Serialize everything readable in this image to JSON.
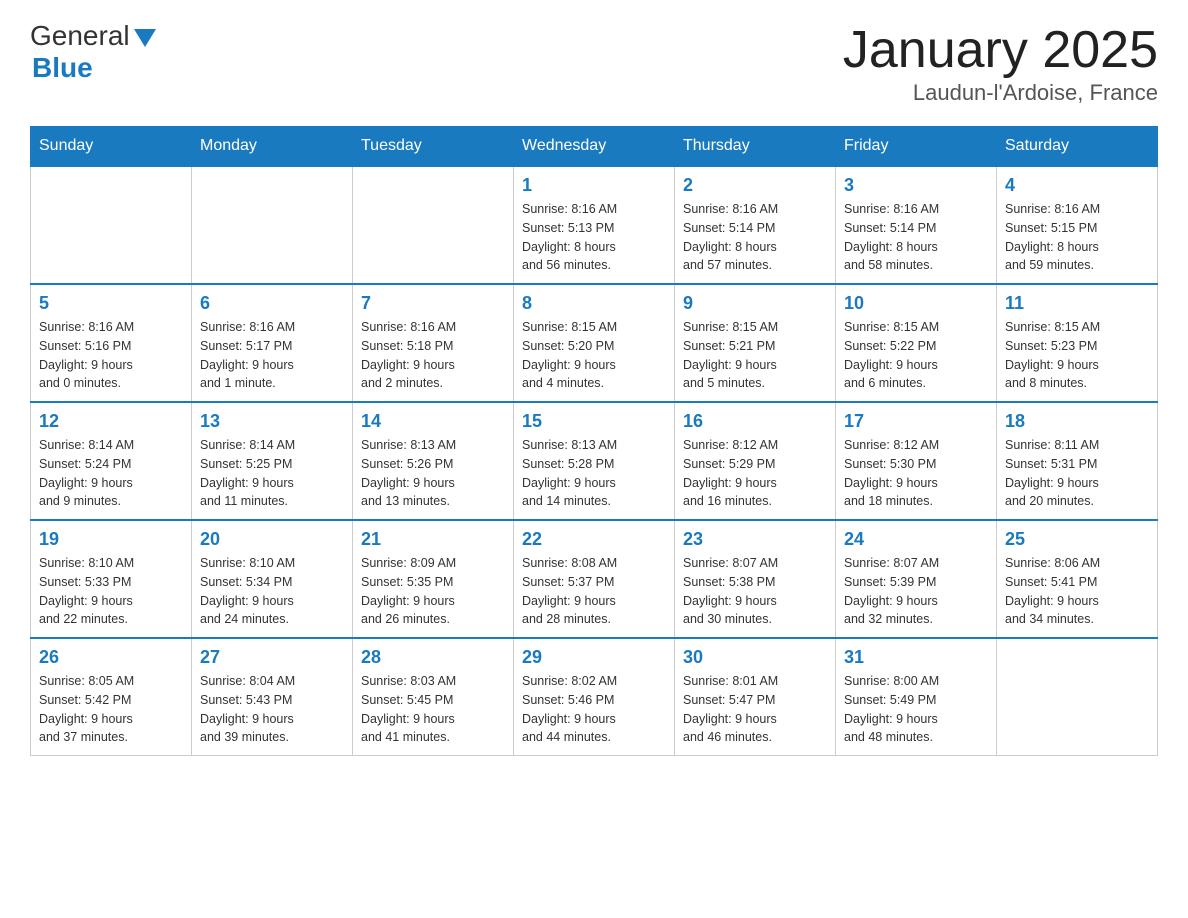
{
  "header": {
    "logo_general": "General",
    "logo_blue": "Blue",
    "month_title": "January 2025",
    "location": "Laudun-l'Ardoise, France"
  },
  "weekdays": [
    "Sunday",
    "Monday",
    "Tuesday",
    "Wednesday",
    "Thursday",
    "Friday",
    "Saturday"
  ],
  "weeks": [
    [
      {
        "day": "",
        "info": ""
      },
      {
        "day": "",
        "info": ""
      },
      {
        "day": "",
        "info": ""
      },
      {
        "day": "1",
        "info": "Sunrise: 8:16 AM\nSunset: 5:13 PM\nDaylight: 8 hours\nand 56 minutes."
      },
      {
        "day": "2",
        "info": "Sunrise: 8:16 AM\nSunset: 5:14 PM\nDaylight: 8 hours\nand 57 minutes."
      },
      {
        "day": "3",
        "info": "Sunrise: 8:16 AM\nSunset: 5:14 PM\nDaylight: 8 hours\nand 58 minutes."
      },
      {
        "day": "4",
        "info": "Sunrise: 8:16 AM\nSunset: 5:15 PM\nDaylight: 8 hours\nand 59 minutes."
      }
    ],
    [
      {
        "day": "5",
        "info": "Sunrise: 8:16 AM\nSunset: 5:16 PM\nDaylight: 9 hours\nand 0 minutes."
      },
      {
        "day": "6",
        "info": "Sunrise: 8:16 AM\nSunset: 5:17 PM\nDaylight: 9 hours\nand 1 minute."
      },
      {
        "day": "7",
        "info": "Sunrise: 8:16 AM\nSunset: 5:18 PM\nDaylight: 9 hours\nand 2 minutes."
      },
      {
        "day": "8",
        "info": "Sunrise: 8:15 AM\nSunset: 5:20 PM\nDaylight: 9 hours\nand 4 minutes."
      },
      {
        "day": "9",
        "info": "Sunrise: 8:15 AM\nSunset: 5:21 PM\nDaylight: 9 hours\nand 5 minutes."
      },
      {
        "day": "10",
        "info": "Sunrise: 8:15 AM\nSunset: 5:22 PM\nDaylight: 9 hours\nand 6 minutes."
      },
      {
        "day": "11",
        "info": "Sunrise: 8:15 AM\nSunset: 5:23 PM\nDaylight: 9 hours\nand 8 minutes."
      }
    ],
    [
      {
        "day": "12",
        "info": "Sunrise: 8:14 AM\nSunset: 5:24 PM\nDaylight: 9 hours\nand 9 minutes."
      },
      {
        "day": "13",
        "info": "Sunrise: 8:14 AM\nSunset: 5:25 PM\nDaylight: 9 hours\nand 11 minutes."
      },
      {
        "day": "14",
        "info": "Sunrise: 8:13 AM\nSunset: 5:26 PM\nDaylight: 9 hours\nand 13 minutes."
      },
      {
        "day": "15",
        "info": "Sunrise: 8:13 AM\nSunset: 5:28 PM\nDaylight: 9 hours\nand 14 minutes."
      },
      {
        "day": "16",
        "info": "Sunrise: 8:12 AM\nSunset: 5:29 PM\nDaylight: 9 hours\nand 16 minutes."
      },
      {
        "day": "17",
        "info": "Sunrise: 8:12 AM\nSunset: 5:30 PM\nDaylight: 9 hours\nand 18 minutes."
      },
      {
        "day": "18",
        "info": "Sunrise: 8:11 AM\nSunset: 5:31 PM\nDaylight: 9 hours\nand 20 minutes."
      }
    ],
    [
      {
        "day": "19",
        "info": "Sunrise: 8:10 AM\nSunset: 5:33 PM\nDaylight: 9 hours\nand 22 minutes."
      },
      {
        "day": "20",
        "info": "Sunrise: 8:10 AM\nSunset: 5:34 PM\nDaylight: 9 hours\nand 24 minutes."
      },
      {
        "day": "21",
        "info": "Sunrise: 8:09 AM\nSunset: 5:35 PM\nDaylight: 9 hours\nand 26 minutes."
      },
      {
        "day": "22",
        "info": "Sunrise: 8:08 AM\nSunset: 5:37 PM\nDaylight: 9 hours\nand 28 minutes."
      },
      {
        "day": "23",
        "info": "Sunrise: 8:07 AM\nSunset: 5:38 PM\nDaylight: 9 hours\nand 30 minutes."
      },
      {
        "day": "24",
        "info": "Sunrise: 8:07 AM\nSunset: 5:39 PM\nDaylight: 9 hours\nand 32 minutes."
      },
      {
        "day": "25",
        "info": "Sunrise: 8:06 AM\nSunset: 5:41 PM\nDaylight: 9 hours\nand 34 minutes."
      }
    ],
    [
      {
        "day": "26",
        "info": "Sunrise: 8:05 AM\nSunset: 5:42 PM\nDaylight: 9 hours\nand 37 minutes."
      },
      {
        "day": "27",
        "info": "Sunrise: 8:04 AM\nSunset: 5:43 PM\nDaylight: 9 hours\nand 39 minutes."
      },
      {
        "day": "28",
        "info": "Sunrise: 8:03 AM\nSunset: 5:45 PM\nDaylight: 9 hours\nand 41 minutes."
      },
      {
        "day": "29",
        "info": "Sunrise: 8:02 AM\nSunset: 5:46 PM\nDaylight: 9 hours\nand 44 minutes."
      },
      {
        "day": "30",
        "info": "Sunrise: 8:01 AM\nSunset: 5:47 PM\nDaylight: 9 hours\nand 46 minutes."
      },
      {
        "day": "31",
        "info": "Sunrise: 8:00 AM\nSunset: 5:49 PM\nDaylight: 9 hours\nand 48 minutes."
      },
      {
        "day": "",
        "info": ""
      }
    ]
  ]
}
